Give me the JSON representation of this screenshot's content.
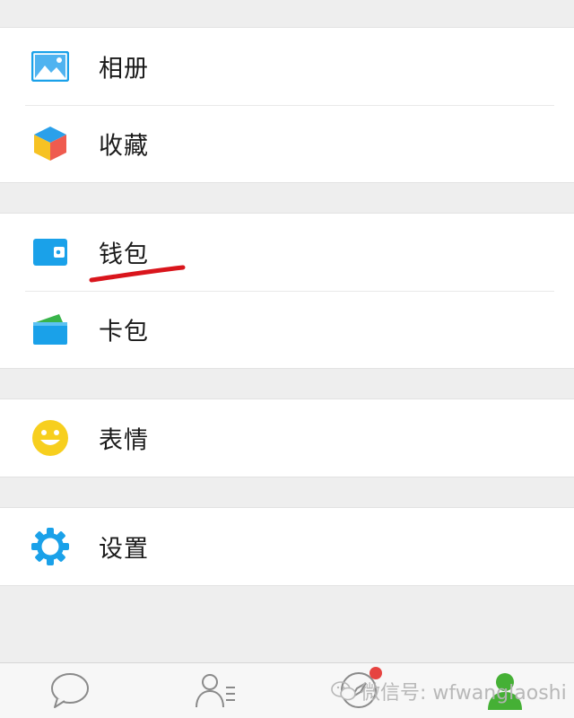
{
  "menu": {
    "groups": [
      {
        "items": [
          {
            "label": "相册",
            "icon": "album-icon"
          },
          {
            "label": "收藏",
            "icon": "favorites-cube-icon"
          }
        ]
      },
      {
        "items": [
          {
            "label": "钱包",
            "icon": "wallet-icon"
          },
          {
            "label": "卡包",
            "icon": "card-wallet-icon"
          }
        ]
      },
      {
        "items": [
          {
            "label": "表情",
            "icon": "smiley-icon"
          }
        ]
      },
      {
        "items": [
          {
            "label": "设置",
            "icon": "gear-icon"
          }
        ]
      }
    ]
  },
  "tabbar": {
    "tabs": [
      {
        "name": "chats",
        "icon": "chat-bubble-icon",
        "active": false
      },
      {
        "name": "contacts",
        "icon": "contacts-icon",
        "active": false
      },
      {
        "name": "discover",
        "icon": "compass-icon",
        "active": false,
        "badge": true
      },
      {
        "name": "me",
        "icon": "person-icon",
        "active": true
      }
    ]
  },
  "watermark": {
    "text": "微信号: wfwanglaoshi"
  },
  "colors": {
    "background": "#eeeeee",
    "row_background": "#ffffff",
    "annotation_red": "#d9151c",
    "active_tab_green": "#45b035",
    "badge_red": "#e64340",
    "blue_icon": "#1aa1e9"
  }
}
